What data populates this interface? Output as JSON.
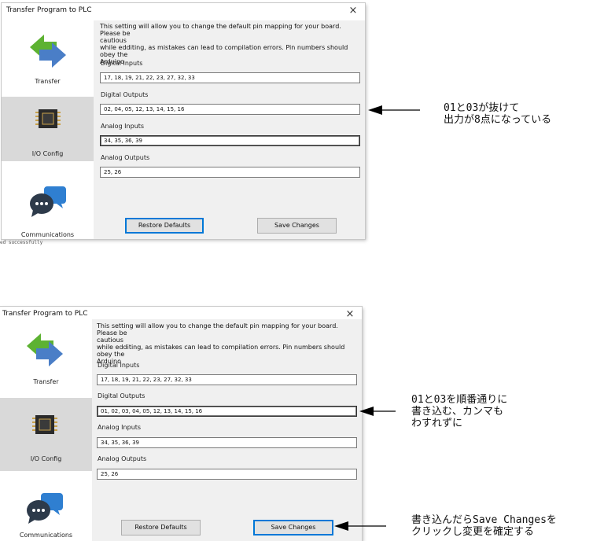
{
  "dialog": {
    "title": "Transfer Program to PLC",
    "close_glyph": "×",
    "sidebar": [
      {
        "label": "Transfer",
        "icon": "transfer-arrows-icon"
      },
      {
        "label": "I/O Config",
        "icon": "chip-icon"
      },
      {
        "label": "Communications",
        "icon": "chat-bubbles-icon"
      }
    ],
    "description": [
      "This setting will allow you to change the default pin mapping for your board. Please be",
      "cautious",
      "while edditing, as mistakes can lead to compilation errors. Pin numbers should obey the",
      "Arduino"
    ],
    "labels": {
      "digital_inputs": "Digital Inputs",
      "digital_outputs": "Digital Outputs",
      "analog_inputs": "Analog Inputs",
      "analog_outputs": "Analog Outputs"
    },
    "buttons": {
      "restore": "Restore Defaults",
      "save": "Save Changes"
    }
  },
  "before": {
    "digital_inputs": "17, 18, 19, 21, 22, 23, 27, 32, 33",
    "digital_outputs": "02, 04, 05, 12, 13, 14, 15, 16",
    "analog_inputs": "34, 35, 36, 39",
    "analog_outputs": "25, 26"
  },
  "after": {
    "digital_inputs": "17, 18, 19, 21, 22, 23, 27, 32, 33",
    "digital_outputs": "01, 02, 03, 04, 05, 12, 13, 14, 15, 16",
    "analog_inputs": "34, 35, 36, 39",
    "analog_outputs": "25, 26"
  },
  "status_text": "ed successfully",
  "annotations": {
    "note1": "01と03が抜けて\n出力が8点になっている",
    "note2": "01と03を順番通りに\n書き込む、カンマも\nわすれずに",
    "note3": "書き込んだらSave Changesを\nクリックし変更を確定する"
  },
  "colors": {
    "panel": "#f0f0f0",
    "active_sidebar": "#d9d9d9",
    "focus_border": "#0078d7"
  }
}
